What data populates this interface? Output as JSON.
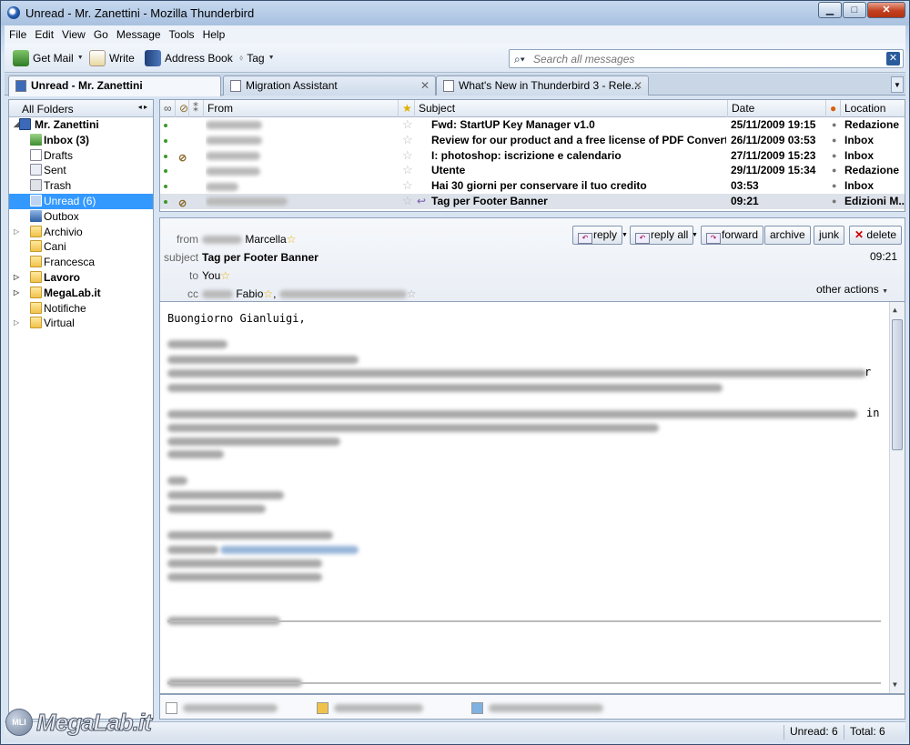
{
  "window": {
    "title": "Unread - Mr. Zanettini - Mozilla Thunderbird",
    "min_label": "▁",
    "max_label": "□",
    "close_label": "✕"
  },
  "menu": [
    "File",
    "Edit",
    "View",
    "Go",
    "Message",
    "Tools",
    "Help"
  ],
  "toolbar": {
    "get_mail": "Get Mail",
    "write": "Write",
    "address_book": "Address Book",
    "tag": "Tag",
    "search_placeholder": "Search all messages"
  },
  "tabs": [
    {
      "label": "Unread - Mr. Zanettini",
      "active": true
    },
    {
      "label": "Migration Assistant",
      "active": false
    },
    {
      "label": "What's New in Thunderbird 3 - Rele...",
      "active": false
    }
  ],
  "folders": {
    "header": "All Folders",
    "account": "Mr. Zanettini",
    "items": [
      {
        "label": "Inbox (3)",
        "bold": true,
        "icon": "inbox-icon"
      },
      {
        "label": "Drafts",
        "bold": false,
        "icon": "drafts-icon"
      },
      {
        "label": "Sent",
        "bold": false,
        "icon": "sent-icon"
      },
      {
        "label": "Trash",
        "bold": false,
        "icon": "trash-icon"
      },
      {
        "label": "Unread (6)",
        "bold": false,
        "icon": "search-folder-icon",
        "selected": true
      },
      {
        "label": "Outbox",
        "bold": false,
        "icon": "outbox-icon"
      },
      {
        "label": "Archivio",
        "bold": false,
        "icon": "folder-icon",
        "expandable": true
      },
      {
        "label": "Cani",
        "bold": false,
        "icon": "folder-icon"
      },
      {
        "label": "Francesca",
        "bold": false,
        "icon": "folder-icon"
      },
      {
        "label": "Lavoro",
        "bold": true,
        "icon": "folder-icon",
        "expandable": true
      },
      {
        "label": "MegaLab.it",
        "bold": true,
        "icon": "folder-icon",
        "expandable": true
      },
      {
        "label": "Notifiche",
        "bold": false,
        "icon": "folder-icon"
      },
      {
        "label": "Virtual",
        "bold": false,
        "icon": "folder-icon",
        "expandable": true
      }
    ]
  },
  "thread": {
    "columns": {
      "from": "From",
      "subject": "Subject",
      "date": "Date",
      "location": "Location"
    },
    "rows": [
      {
        "subject": "Fwd: StartUP Key Manager v1.0",
        "date": "25/11/2009 19:15",
        "location": "Redazione",
        "attach": false
      },
      {
        "subject": "Review for our product and a free license of PDF Converter ...",
        "date": "26/11/2009 03:53",
        "location": "Inbox",
        "attach": false
      },
      {
        "subject": "I: photoshop: iscrizione e calendario",
        "date": "27/11/2009 15:23",
        "location": "Inbox",
        "attach": true
      },
      {
        "subject": "Utente",
        "date": "29/11/2009 15:34",
        "location": "Redazione",
        "attach": false
      },
      {
        "subject": "Hai 30 giorni per conservare il tuo credito",
        "date": "03:53",
        "location": "Inbox",
        "attach": false
      },
      {
        "subject": "Tag per Footer Banner",
        "date": "09:21",
        "location": "Edizioni M...",
        "attach": true,
        "selected": true,
        "replied": true
      }
    ]
  },
  "message": {
    "labels": {
      "from": "from",
      "subject": "subject",
      "to": "to",
      "cc": "cc"
    },
    "from": "Marcella",
    "subject": "Tag per Footer Banner",
    "to": "You",
    "cc": "Fabio",
    "time": "09:21",
    "buttons": {
      "reply": "reply",
      "reply_all": "reply all",
      "forward": "forward",
      "archive": "archive",
      "junk": "junk",
      "delete": "delete"
    },
    "other_actions": "other actions",
    "greeting": "Buongiorno Gianluigi,",
    "visible_tail_1": "r",
    "visible_tail_2": "in"
  },
  "status": {
    "unread": "Unread: 6",
    "total": "Total: 6"
  },
  "watermark": {
    "badge": "MLI",
    "text": "MegaLab.it"
  }
}
